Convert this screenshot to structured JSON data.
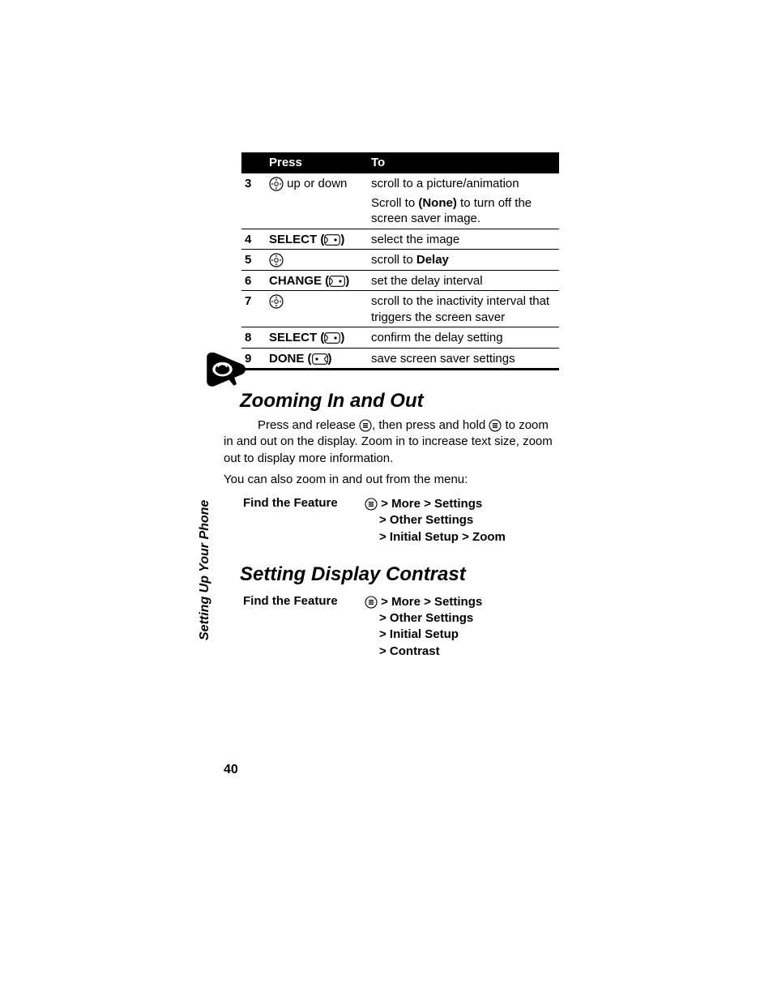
{
  "side_label": "Setting Up Your Phone",
  "page_number": "40",
  "table": {
    "head": {
      "press": "Press",
      "to": "To"
    },
    "rows": [
      {
        "n": "3",
        "press_pre": "",
        "icon": "nav",
        "press_post": " up or down",
        "to": "scroll to a picture/animation",
        "to2_pre": "Scroll to ",
        "to2_semi": "(None)",
        "to2_post": " to turn off the screen saver image."
      },
      {
        "n": "4",
        "press_pre": "SELECT",
        "icon": "soft-r",
        "to": "select the image"
      },
      {
        "n": "5",
        "icon": "nav",
        "to_pre": "scroll to ",
        "to_semi": "Delay"
      },
      {
        "n": "6",
        "press_pre": "CHANGE",
        "icon": "soft-r",
        "to": "set the delay interval"
      },
      {
        "n": "7",
        "icon": "nav",
        "to": "scroll to the inactivity interval that triggers the screen saver"
      },
      {
        "n": "8",
        "press_pre": "SELECT",
        "icon": "soft-r",
        "to": "confirm the delay setting"
      },
      {
        "n": "9",
        "press_pre": "DONE",
        "icon": "soft-l",
        "to": "save screen saver settings"
      }
    ]
  },
  "zoom": {
    "heading": "Zooming In and Out",
    "p1_a": "Press and release ",
    "p1_b": ", then press and hold ",
    "p1_c": " to zoom in and out on the display. Zoom in to increase text size, zoom out to display more information.",
    "p2": "You can also zoom in and out from the menu:",
    "ftf_label": "Find the Feature",
    "ftf_lines": [
      {
        "icon": true,
        "text": " > More > Settings"
      },
      {
        "indent": true,
        "text": "> Other Settings"
      },
      {
        "indent": true,
        "text": "> Initial Setup > Zoom"
      }
    ]
  },
  "contrast": {
    "heading": "Setting Display Contrast",
    "ftf_label": "Find the Feature",
    "ftf_lines": [
      {
        "icon": true,
        "text": " > More > Settings"
      },
      {
        "indent": true,
        "text": "> Other Settings"
      },
      {
        "indent": true,
        "text": "> Initial Setup"
      },
      {
        "indent": true,
        "text": "> Contrast"
      }
    ]
  }
}
